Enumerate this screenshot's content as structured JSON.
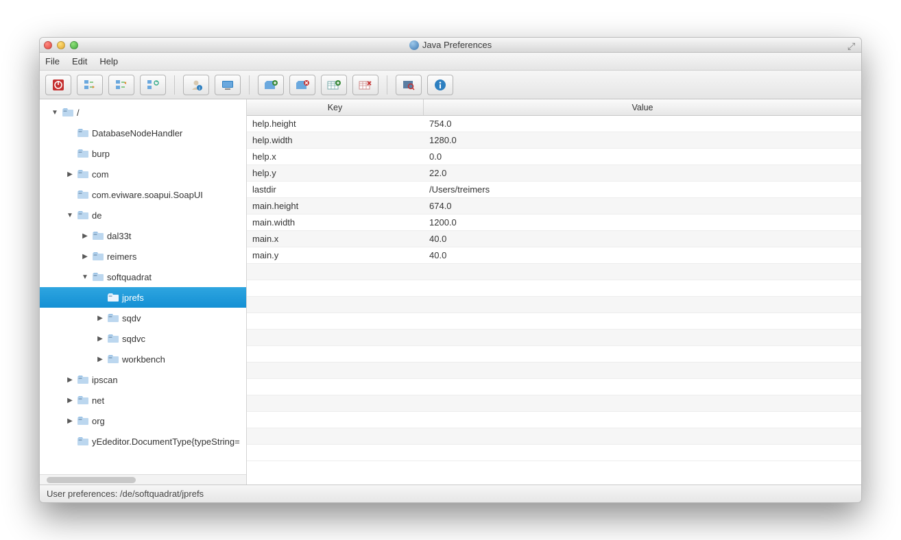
{
  "window": {
    "title": "Java Preferences"
  },
  "menu": {
    "file": "File",
    "edit": "Edit",
    "help": "Help"
  },
  "tree": {
    "items": [
      {
        "label": "/",
        "depth": 0,
        "arrow": "down",
        "icon": "folder"
      },
      {
        "label": "DatabaseNodeHandler",
        "depth": 1,
        "arrow": "none",
        "icon": "folder"
      },
      {
        "label": "burp",
        "depth": 1,
        "arrow": "none",
        "icon": "folder"
      },
      {
        "label": "com",
        "depth": 1,
        "arrow": "right",
        "icon": "folder"
      },
      {
        "label": "com.eviware.soapui.SoapUI",
        "depth": 1,
        "arrow": "none",
        "icon": "folder"
      },
      {
        "label": "de",
        "depth": 1,
        "arrow": "down",
        "icon": "folder"
      },
      {
        "label": "dal33t",
        "depth": 2,
        "arrow": "right",
        "icon": "folder"
      },
      {
        "label": "reimers",
        "depth": 2,
        "arrow": "right",
        "icon": "folder"
      },
      {
        "label": "softquadrat",
        "depth": 2,
        "arrow": "down",
        "icon": "folder"
      },
      {
        "label": "jprefs",
        "depth": 3,
        "arrow": "none",
        "icon": "folder",
        "selected": true
      },
      {
        "label": "sqdv",
        "depth": 3,
        "arrow": "right",
        "icon": "folder"
      },
      {
        "label": "sqdvc",
        "depth": 3,
        "arrow": "right",
        "icon": "folder"
      },
      {
        "label": "workbench",
        "depth": 3,
        "arrow": "right",
        "icon": "folder"
      },
      {
        "label": "ipscan",
        "depth": 1,
        "arrow": "right",
        "icon": "folder"
      },
      {
        "label": "net",
        "depth": 1,
        "arrow": "right",
        "icon": "folder"
      },
      {
        "label": "org",
        "depth": 1,
        "arrow": "right",
        "icon": "folder"
      },
      {
        "label": "yEdeditor.DocumentType{typeString=",
        "depth": 1,
        "arrow": "none",
        "icon": "folder"
      }
    ]
  },
  "table": {
    "headers": {
      "key": "Key",
      "value": "Value"
    },
    "rows": [
      {
        "key": "help.height",
        "value": "754.0"
      },
      {
        "key": "help.width",
        "value": "1280.0"
      },
      {
        "key": "help.x",
        "value": "0.0"
      },
      {
        "key": "help.y",
        "value": "22.0"
      },
      {
        "key": "lastdir",
        "value": "/Users/treimers"
      },
      {
        "key": "main.height",
        "value": "674.0"
      },
      {
        "key": "main.width",
        "value": "1200.0"
      },
      {
        "key": "main.x",
        "value": "40.0"
      },
      {
        "key": "main.y",
        "value": "40.0"
      }
    ]
  },
  "status": {
    "text": "User preferences: /de/softquadrat/jprefs"
  }
}
